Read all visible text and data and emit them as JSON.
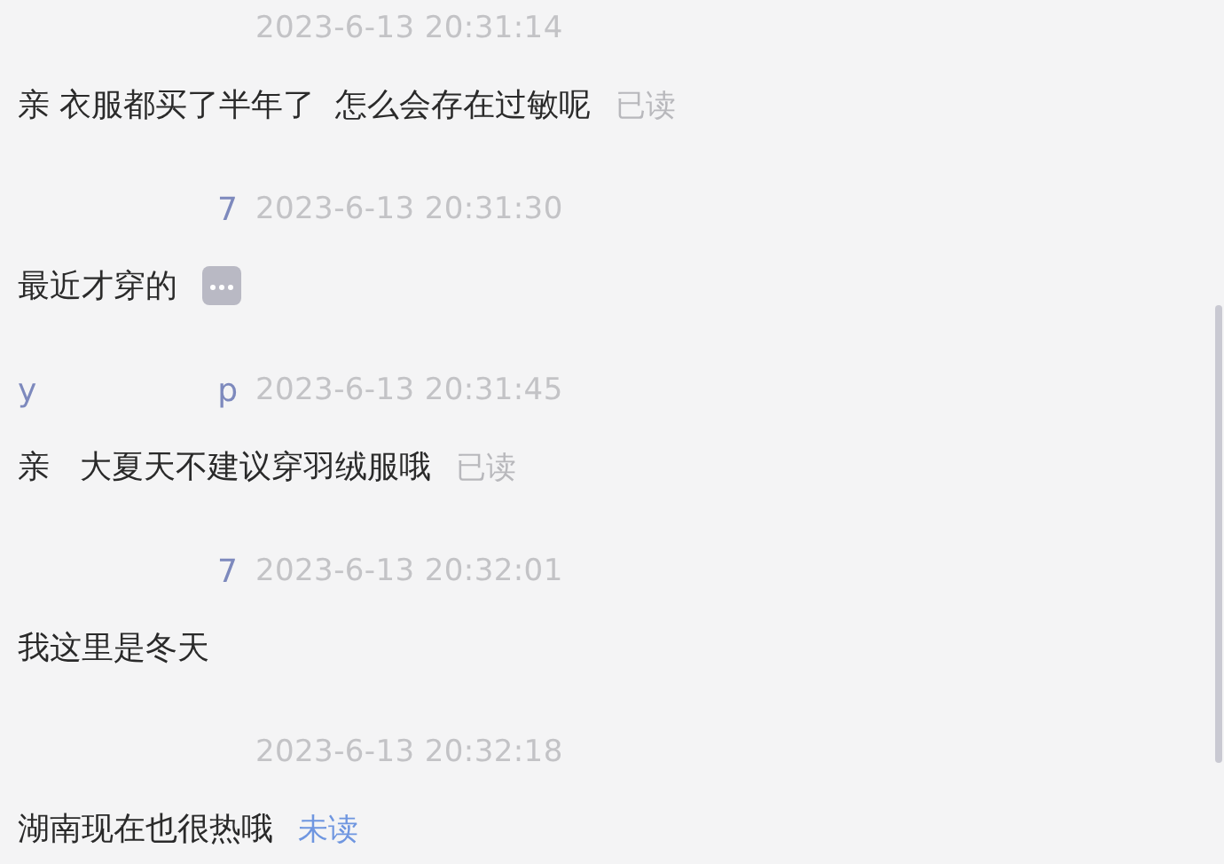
{
  "messages": [
    {
      "time": "2023-6-13 20:31:14",
      "text": "亲 衣服都买了半年了  怎么会存在过敏呢",
      "status": {
        "kind": "read",
        "label": "已读"
      }
    },
    {
      "name_fragments": [
        "7"
      ],
      "time": "2023-6-13 20:31:30",
      "text": "最近才穿的",
      "status": {
        "kind": "more-icon"
      }
    },
    {
      "name_fragments": [
        "y",
        "p"
      ],
      "time": "2023-6-13 20:31:45",
      "text": "亲   大夏天不建议穿羽绒服哦",
      "status": {
        "kind": "read",
        "label": "已读"
      }
    },
    {
      "name_fragments": [
        "7"
      ],
      "time": "2023-6-13 20:32:01",
      "text": "我这里是冬天",
      "status": {
        "kind": "none"
      }
    },
    {
      "time": "2023-6-13 20:32:18",
      "text": "湖南现在也很热哦",
      "status": {
        "kind": "unread",
        "label": "未读"
      }
    }
  ]
}
